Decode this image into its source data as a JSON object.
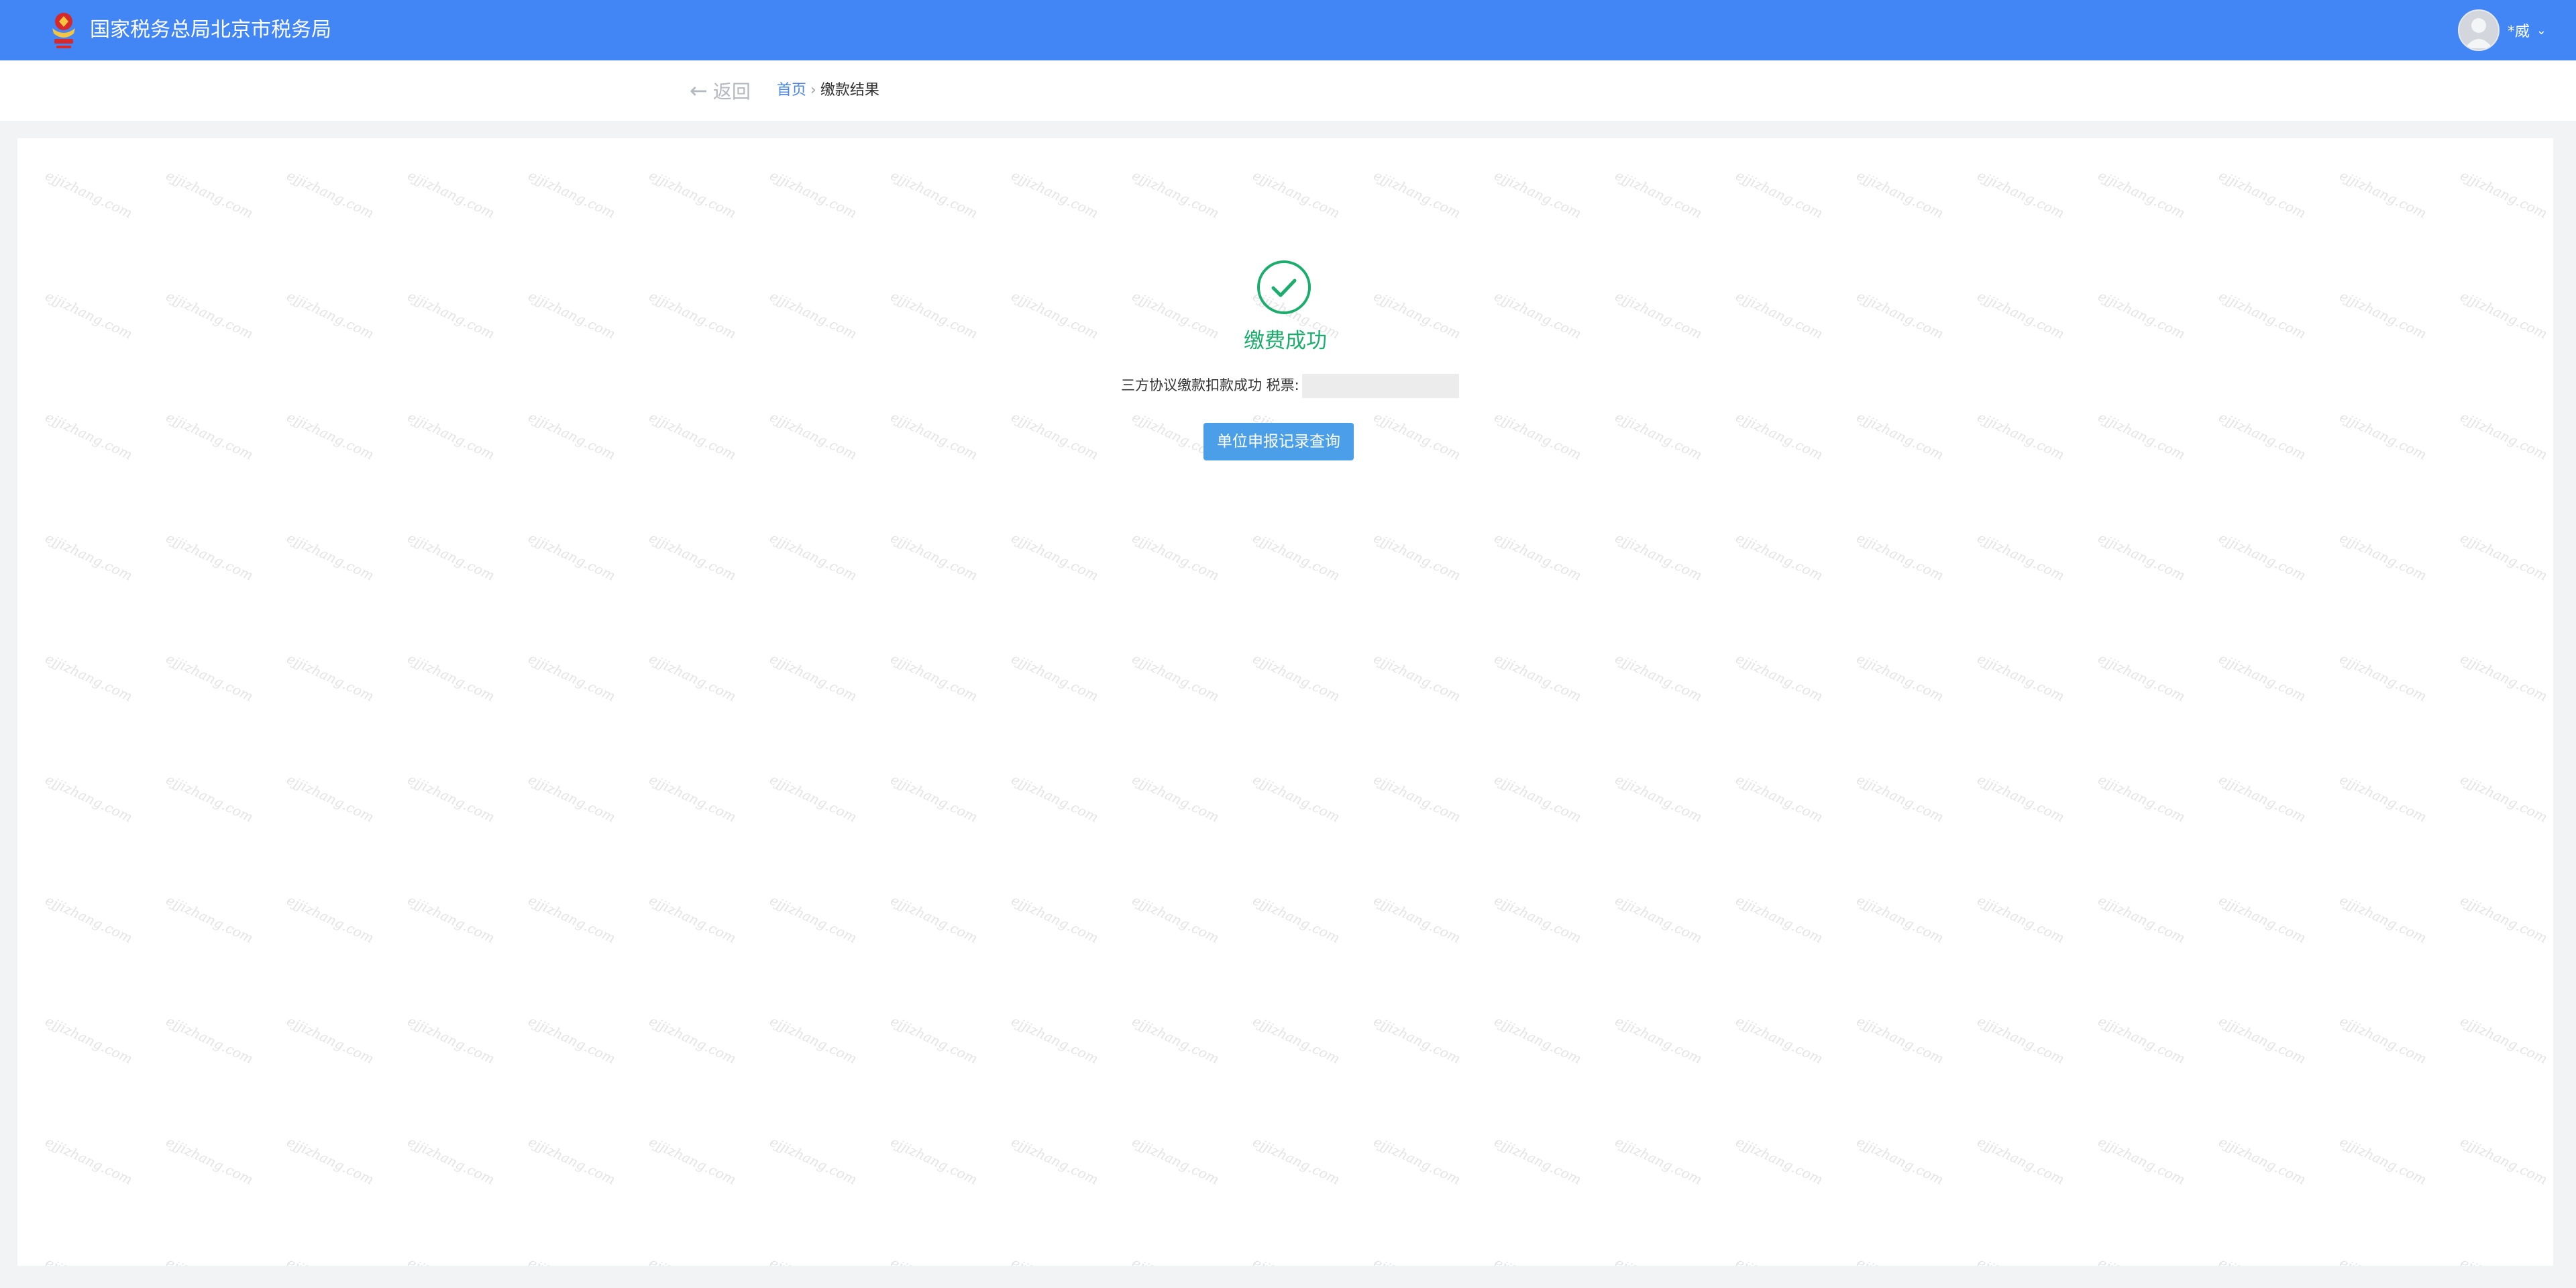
{
  "header": {
    "org_title": "国家税务总局北京市税务局",
    "user_name": "*威",
    "logo_icon": "tax-emblem-icon",
    "accent_color": "#4285f4"
  },
  "nav": {
    "back_label": "返回",
    "breadcrumb": {
      "home": "首页",
      "separator": "›",
      "current": "缴款结果"
    }
  },
  "result": {
    "status_icon": "check-circle-icon",
    "status_color": "#1aad6b",
    "title": "缴费成功",
    "message": "三方协议缴款扣款成功 税票:",
    "button_label": "单位申报记录查询"
  },
  "watermark": {
    "text": "ejjizhang.com"
  }
}
